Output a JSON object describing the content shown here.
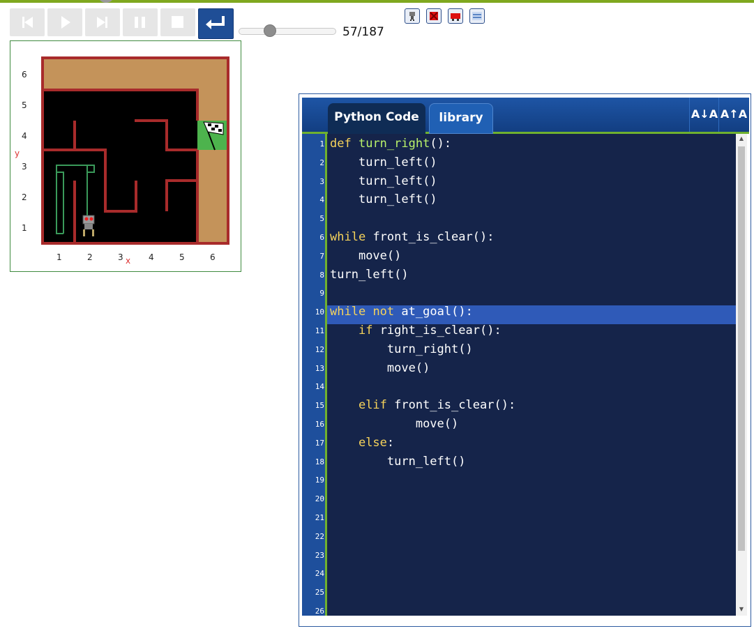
{
  "toolbar": {
    "step_current": "57",
    "step_separator": "/",
    "step_total": "187",
    "buttons": [
      "reset-to-start-icon",
      "run-icon",
      "step-forward-icon",
      "pause-icon",
      "stop-icon",
      "return-to-editor-icon"
    ],
    "tools": [
      "robot-icon",
      "red-box-icon",
      "red-car-icon",
      "map-icon"
    ]
  },
  "world": {
    "y_label": "y",
    "x_label": "x",
    "row_labels": [
      "6",
      "5",
      "4",
      "3",
      "2",
      "1"
    ],
    "col_labels": [
      "1",
      "2",
      "3",
      "4",
      "5",
      "6"
    ],
    "colors": {
      "wall": "#a82b2b",
      "floor": "#000000",
      "sand": "#c4935a",
      "goal": "#4db34d",
      "path": "#3a9a5a"
    }
  },
  "editor": {
    "tabs": [
      "Python Code",
      "library"
    ],
    "font_decrease": "A↓A",
    "font_increase": "A↑A",
    "highlighted_line": 10,
    "line_numbers": [
      "1",
      "2",
      "3",
      "4",
      "5",
      "6",
      "7",
      "8",
      "9",
      "10",
      "11",
      "12",
      "13",
      "14",
      "15",
      "16",
      "17",
      "18",
      "19",
      "20",
      "21",
      "22",
      "23",
      "24",
      "25",
      "26"
    ],
    "lines": [
      "def turn_right():",
      "    turn_left()",
      "    turn_left()",
      "    turn_left()",
      "",
      "while front_is_clear():",
      "    move()",
      "turn_left()",
      "",
      "while not at_goal():",
      "    if right_is_clear():",
      "        turn_right()",
      "        move()",
      "",
      "    elif front_is_clear():",
      "            move()",
      "    else:",
      "        turn_left()",
      "",
      "",
      "",
      "",
      "",
      "",
      "",
      ""
    ]
  }
}
